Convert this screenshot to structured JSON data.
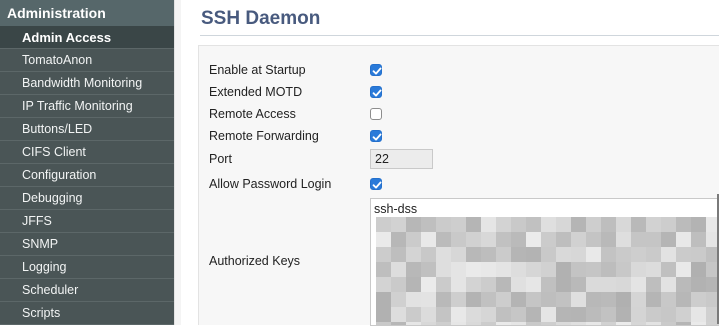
{
  "sidebar": {
    "header": "Administration",
    "items": [
      {
        "label": "Admin Access",
        "active": true
      },
      {
        "label": "TomatoAnon"
      },
      {
        "label": "Bandwidth Monitoring"
      },
      {
        "label": "IP Traffic Monitoring"
      },
      {
        "label": "Buttons/LED"
      },
      {
        "label": "CIFS Client"
      },
      {
        "label": "Configuration"
      },
      {
        "label": "Debugging"
      },
      {
        "label": "JFFS"
      },
      {
        "label": "SNMP"
      },
      {
        "label": "Logging"
      },
      {
        "label": "Scheduler"
      },
      {
        "label": "Scripts"
      }
    ]
  },
  "main": {
    "title": "SSH Daemon",
    "fields": {
      "enable_startup": {
        "label": "Enable at Startup",
        "checked": true
      },
      "extended_motd": {
        "label": "Extended MOTD",
        "checked": true
      },
      "remote_access": {
        "label": "Remote Access",
        "checked": false
      },
      "remote_forwarding": {
        "label": "Remote Forwarding",
        "checked": true
      },
      "port": {
        "label": "Port",
        "value": "22"
      },
      "allow_password": {
        "label": "Allow Password Login",
        "checked": true
      },
      "authorized_keys": {
        "label": "Authorized Keys",
        "value_visible": "ssh-dss",
        "rest": "pixelated (redacted)"
      }
    }
  },
  "colors": {
    "sidebar_bg": "#4a5556",
    "sidebar_active": "#3a4647",
    "title": "#485a7e",
    "checkbox_checked": "#2a7ad9"
  }
}
